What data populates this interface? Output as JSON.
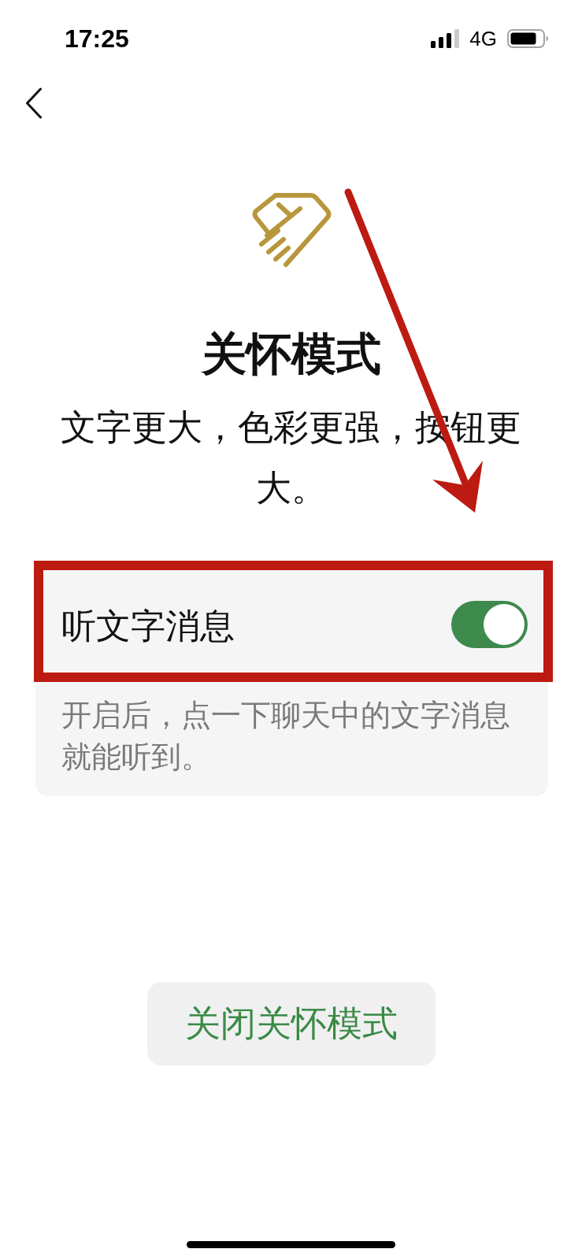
{
  "status_bar": {
    "time": "17:25",
    "network": "4G"
  },
  "header": {
    "title": "关怀模式",
    "subtitle": "文字更大，色彩更强，按钮更大。"
  },
  "settings": [
    {
      "kind": "toggle",
      "label": "听文字消息",
      "on": true,
      "highlighted": true,
      "description": "开启后，点一下聊天中的文字消息就能听到。"
    }
  ],
  "button": {
    "label": "关闭关怀模式"
  },
  "annotations": [
    {
      "kind": "arrow"
    }
  ]
}
